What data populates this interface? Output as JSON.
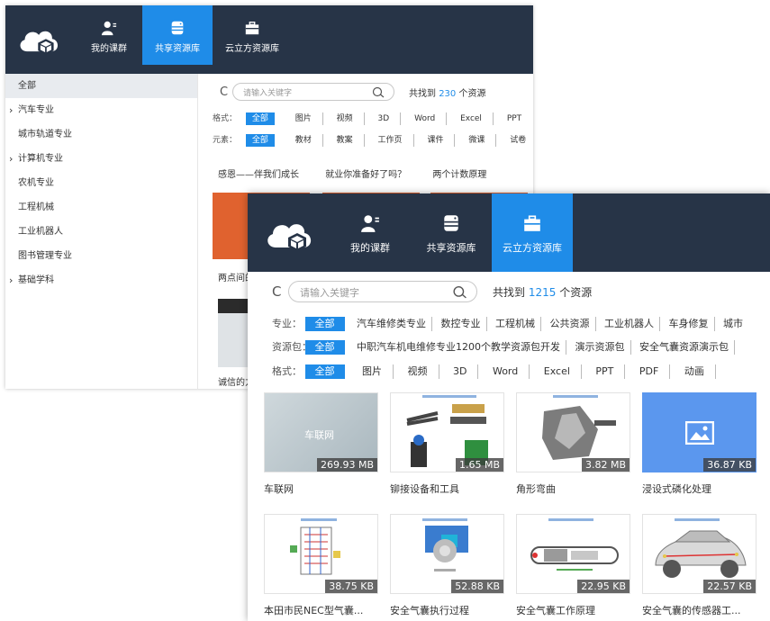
{
  "back_window": {
    "nav": [
      {
        "label": "我的课群",
        "icon": "user-icon",
        "active": false
      },
      {
        "label": "共享资源库",
        "icon": "database-icon",
        "active": true
      },
      {
        "label": "云立方资源库",
        "icon": "briefcase-icon",
        "active": false
      }
    ],
    "sidebar": [
      {
        "label": "全部",
        "active": true,
        "arrow": false
      },
      {
        "label": "汽车专业",
        "active": false,
        "arrow": true
      },
      {
        "label": "城市轨道专业",
        "active": false,
        "arrow": false
      },
      {
        "label": "计算机专业",
        "active": false,
        "arrow": true
      },
      {
        "label": "农机专业",
        "active": false,
        "arrow": false
      },
      {
        "label": "工程机械",
        "active": false,
        "arrow": false
      },
      {
        "label": "工业机器人",
        "active": false,
        "arrow": false
      },
      {
        "label": "图书管理专业",
        "active": false,
        "arrow": false
      },
      {
        "label": "基础学科",
        "active": false,
        "arrow": true
      }
    ],
    "search_placeholder": "请输入关键字",
    "found_prefix": "共找到",
    "found_count": "230",
    "found_suffix": "个资源",
    "filters": [
      {
        "label": "格式：",
        "options": [
          "全部",
          "图片",
          "视频",
          "3D",
          "Word",
          "Excel",
          "PPT"
        ]
      },
      {
        "label": "元素：",
        "options": [
          "全部",
          "教材",
          "教案",
          "工作页",
          "课件",
          "微课",
          "试卷"
        ]
      }
    ],
    "topics": [
      "感恩——伴我们成长",
      "就业你准备好了吗？",
      "两个计数原理"
    ],
    "partial_caption_1": "两点间的",
    "partial_caption_2": "诚信的力"
  },
  "front_window": {
    "nav": [
      {
        "label": "我的课群",
        "icon": "user-icon",
        "active": false
      },
      {
        "label": "共享资源库",
        "icon": "database-icon",
        "active": false
      },
      {
        "label": "云立方资源库",
        "icon": "briefcase-icon",
        "active": true
      }
    ],
    "search_placeholder": "请输入关键字",
    "found_prefix": "共找到",
    "found_count": "1215",
    "found_suffix": "个资源",
    "filters": [
      {
        "label": "专业：",
        "options": [
          "全部",
          "汽车维修类专业",
          "数控专业",
          "工程机械",
          "公共资源",
          "工业机器人",
          "车身修复",
          "城市"
        ]
      },
      {
        "label": "资源包：",
        "options": [
          "全部",
          "中职汽车机电维修专业1200个教学资源包开发",
          "演示资源包",
          "安全气囊资源演示包"
        ]
      },
      {
        "label": "格式：",
        "options": [
          "全部",
          "图片",
          "视频",
          "3D",
          "Word",
          "Excel",
          "PPT",
          "PDF",
          "动画"
        ]
      }
    ],
    "resources": [
      {
        "title": "车联网",
        "size": "269.93 MB",
        "thumb_text": "车联网"
      },
      {
        "title": "铆接设备和工具",
        "size": "1.65 MB",
        "thumb_text": ""
      },
      {
        "title": "角形弯曲",
        "size": "3.82 MB",
        "thumb_text": ""
      },
      {
        "title": "浸设式磷化处理",
        "size": "36.87 KB",
        "thumb_text": ""
      },
      {
        "title": "本田市民NEC型气囊...",
        "size": "38.75 KB",
        "thumb_text": ""
      },
      {
        "title": "安全气囊执行过程",
        "size": "52.88 KB",
        "thumb_text": ""
      },
      {
        "title": "安全气囊工作原理",
        "size": "22.95 KB",
        "thumb_text": ""
      },
      {
        "title": "安全气囊的传感器工...",
        "size": "22.57 KB",
        "thumb_text": ""
      }
    ],
    "colors": {
      "header": "#273447",
      "accent": "#1f8ce8",
      "orange": "#e0622f"
    }
  }
}
